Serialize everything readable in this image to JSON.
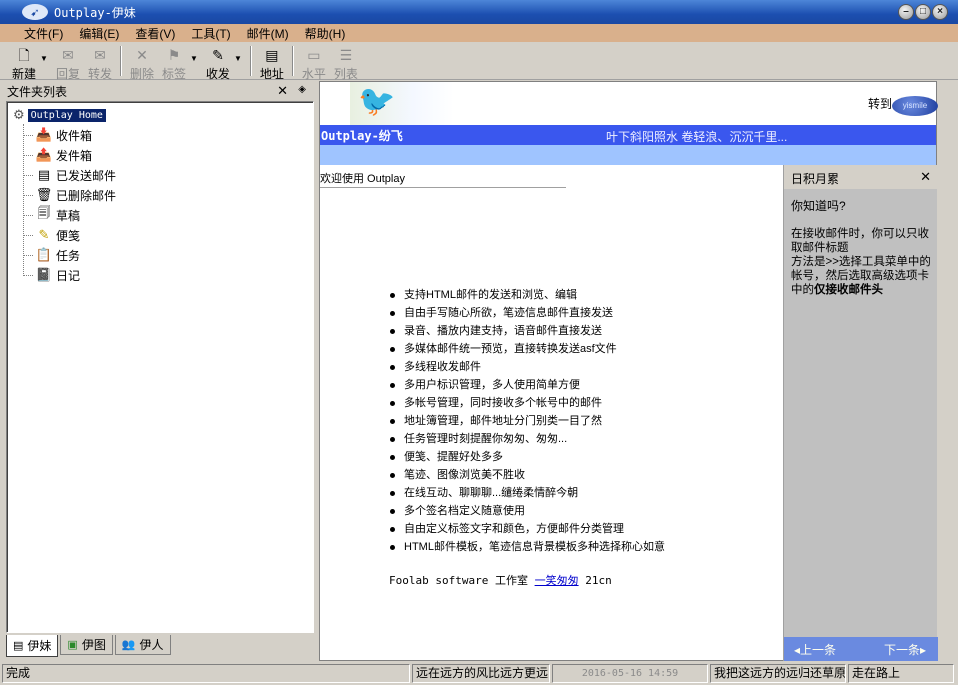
{
  "window": {
    "title": "Outplay-伊妹",
    "controls": [
      "minimize",
      "maximize",
      "close"
    ]
  },
  "menu": [
    "文件(F)",
    "编辑(E)",
    "查看(V)",
    "工具(T)",
    "邮件(M)",
    "帮助(H)"
  ],
  "toolbar": {
    "new": "新建",
    "reply": "回复",
    "forward": "转发",
    "delete": "删除",
    "tag": "标签",
    "send_receive": "收发",
    "address": "地址",
    "horizontal": "水平",
    "list": "列表"
  },
  "folder_pane": {
    "header": "文件夹列表",
    "root": "Outplay Home",
    "items": [
      "收件箱",
      "发件箱",
      "已发送邮件",
      "已删除邮件",
      "草稿",
      "便笺",
      "任务",
      "日记"
    ],
    "tabs": [
      "伊妹",
      "伊图",
      "伊人"
    ]
  },
  "banner": {
    "goto": "转到",
    "logo_text": "yismile",
    "brand": "Outplay-纷飞",
    "slogan": "叶下斜阳照水 卷轻浪、沉沉千里..."
  },
  "content": {
    "welcome_title": "欢迎使用 Outplay",
    "features": [
      "支持HTML邮件的发送和浏览、编辑",
      "自由手写随心所欲，笔迹信息邮件直接发送",
      "录音、播放内建支持，语音邮件直接发送",
      "多媒体邮件统一预览，直接转换发送asf文件",
      "多线程收发邮件",
      "多用户标识管理，多人使用简单方便",
      "多帐号管理，同时接收多个帐号中的邮件",
      "地址簿管理，邮件地址分门别类一目了然",
      "任务管理时刻提醒你匆匆、匆匆...",
      "便笺、提醒好处多多",
      "笔迹、图像浏览美不胜收",
      "在线互动、聊聊聊...缱绻柔情醉今朝",
      "多个签名档定义随意使用",
      "自由定义标签文字和颜色，方便邮件分类管理",
      "HTML邮件模板，笔迹信息背景模板多种选择称心如意"
    ],
    "footer_prefix": "Foolab software 工作室",
    "footer_link": "一笑匆匆",
    "footer_suffix": "21cn"
  },
  "tips": {
    "title": "日积月累",
    "question": "你知道吗?",
    "body_line1": "在接收邮件时，你可以只收取邮件标题",
    "body_line2": "方法是>>选择工具菜单中的帐号，然后选取高级选项卡中的",
    "body_bold": "仅接收邮件头",
    "prev": "上一条",
    "next": "下一条"
  },
  "statusbar": {
    "status": "完成",
    "msg1": "远在远方的风比远方更远",
    "date": "2016-05-16 14:59",
    "msg2": "我把这远方的远归还草原",
    "msg3": "走在路上"
  },
  "colors": {
    "titlebar": "#1c4fb0",
    "menubar": "#d9b08c",
    "banner_bar": "#3a57ee",
    "banner_strip": "#9fc4ff",
    "tip_nav": "#6a8ae0"
  }
}
